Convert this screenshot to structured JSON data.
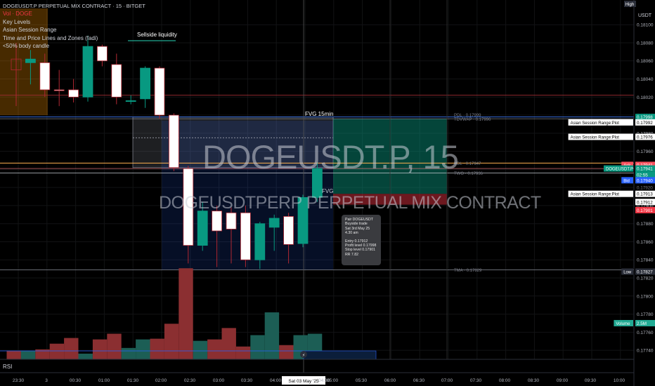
{
  "legend": {
    "title": "DOGEUSDT.P PERPETUAL MIX CONTRACT · 15 · BITGET",
    "vol": "Vol · DOGE",
    "indicators": [
      "Key Levels",
      "Asian Session Range",
      "Time and Price Lines and Zones (fadi)",
      "&lt;50% body candle"
    ]
  },
  "watermark": {
    "symbol": "DOGEUSDT.P, 15",
    "description": "DOGEUSDTPERP PERPETUAL MIX CONTRACT"
  },
  "annotations": {
    "sellside": "Sellside liquidity",
    "fvg_top": "FVG 15min",
    "fvg_mid": "FVG"
  },
  "key_levels": [
    {
      "label": "PDL · 0.17999",
      "value": 0.17998
    },
    {
      "label": "TDVWAP · 0.17996",
      "value": 0.17996
    },
    {
      "label": "YDL · 0.17947",
      "value": 0.17947
    },
    {
      "label": "TWO · 0.17936",
      "value": 0.17936
    },
    {
      "label": "TMA · 0.17829",
      "value": 0.17829
    }
  ],
  "tooltip": {
    "lines": [
      "Pair DOGEUSDT",
      "Buyside trade",
      "Sat 3rd May 25",
      "4.30 am"
    ],
    "lines2": [
      "Entry 0.17912",
      "Profit level 0.17998",
      "Stop level 0.17901",
      "RR 7.82"
    ]
  },
  "price_axis": {
    "currency": "USDT",
    "high_badge": "High",
    "ticks": [
      "0.18100",
      "0.18080",
      "0.18060",
      "0.18040",
      "0.18020",
      "0.18000",
      "0.17980",
      "0.17960",
      "0.17940",
      "0.17920",
      "0.17900",
      "0.17880",
      "0.17860",
      "0.17840",
      "0.17820",
      "0.17800",
      "0.17780",
      "0.17760",
      "0.17740"
    ],
    "badges": [
      {
        "label": "",
        "text": "0.17998",
        "bg": "#089981",
        "fg": "#ffffff",
        "value": 0.17998
      },
      {
        "label": "Asian Session Range:Plot",
        "text": "0.17992",
        "bg": "#ffffff",
        "fg": "#000000",
        "value": 0.17992
      },
      {
        "label": "Asian Session Range:Plot",
        "text": "0.17976",
        "bg": "#ffffff",
        "fg": "#000000",
        "value": 0.17976
      },
      {
        "label": "Ask",
        "text": "0.17941",
        "bg": "#f7525f",
        "fg": "#ffffff",
        "value": 0.17945
      },
      {
        "label": "DOGEUSDT.P",
        "text": "0.17941",
        "bg": "#089981",
        "fg": "#ffffff",
        "value": 0.17941
      },
      {
        "label": "",
        "text": "02:55",
        "bg": "#089981",
        "fg": "#ffffff",
        "value": 0.17934
      },
      {
        "label": "Bid",
        "text": "0.17940",
        "bg": "#2962ff",
        "fg": "#ffffff",
        "value": 0.17928
      },
      {
        "label": "",
        "text": "0.17920",
        "bg": "#000000",
        "fg": "#787b86",
        "value": 0.1792
      },
      {
        "label": "Asian Session Range:Plot",
        "text": "0.17913",
        "bg": "#ffffff",
        "fg": "#000000",
        "value": 0.17913
      },
      {
        "label": "",
        "text": "0.17912",
        "bg": "#ffffff",
        "fg": "#000000",
        "value": 0.17904
      },
      {
        "label": "",
        "text": "0.17901",
        "bg": "#f23645",
        "fg": "#ffffff",
        "value": 0.17895
      },
      {
        "label": "Low",
        "text": "0.17827",
        "bg": "#2a2e39",
        "fg": "#ffffff",
        "value": 0.17827
      },
      {
        "label": "Volume",
        "text": "2.5M",
        "bg": "#22ab94",
        "fg": "#ffffff",
        "value": 0.1777
      }
    ]
  },
  "time_axis": {
    "ticks": [
      "23:30",
      "3",
      "00:30",
      "01:00",
      "01:30",
      "02:00",
      "02:30",
      "03:00",
      "03:30",
      "04:00",
      "04:30",
      "05:00",
      "05:30",
      "06:00",
      "06:30",
      "07:00",
      "07:30",
      "08:00",
      "08:30",
      "09:00",
      "09:30",
      "10:00"
    ],
    "crosshair_label": "Sat 03 May '25"
  },
  "rsi_label": "RSI",
  "colors": {
    "up": "#089981",
    "down": "#f23645",
    "vol_up": "#1c5e55",
    "vol_down": "#8b2f31"
  },
  "chart_data": {
    "type": "candlestick",
    "timeframe": "15",
    "ylim": [
      0.1773,
      0.18118
    ],
    "candles": [
      {
        "t": "23:15",
        "o": 0.18062,
        "h": 0.1808,
        "l": 0.1801,
        "c": 0.1805
      },
      {
        "t": "23:30",
        "o": 0.18058,
        "h": 0.18072,
        "l": 0.18034,
        "c": 0.18062
      },
      {
        "t": "23:45",
        "o": 0.18058,
        "h": 0.18068,
        "l": 0.1802,
        "c": 0.18028
      },
      {
        "t": "00:00",
        "o": 0.18028,
        "h": 0.1805,
        "l": 0.1801,
        "c": 0.18027
      },
      {
        "t": "00:15",
        "o": 0.18028,
        "h": 0.1804,
        "l": 0.18014,
        "c": 0.1802
      },
      {
        "t": "00:30",
        "o": 0.1802,
        "h": 0.18088,
        "l": 0.18015,
        "c": 0.18076
      },
      {
        "t": "00:45",
        "o": 0.18076,
        "h": 0.18078,
        "l": 0.18054,
        "c": 0.1806
      },
      {
        "t": "01:00",
        "o": 0.18056,
        "h": 0.18068,
        "l": 0.18012,
        "c": 0.1802
      },
      {
        "t": "01:15",
        "o": 0.18016,
        "h": 0.18022,
        "l": 0.18012,
        "c": 0.18016
      },
      {
        "t": "01:30",
        "o": 0.18018,
        "h": 0.18054,
        "l": 0.18008,
        "c": 0.18052
      },
      {
        "t": "01:45",
        "o": 0.18052,
        "h": 0.18054,
        "l": 0.17996,
        "c": 0.18
      },
      {
        "t": "02:00",
        "o": 0.18,
        "h": 0.18002,
        "l": 0.17938,
        "c": 0.17942
      },
      {
        "t": "02:15",
        "o": 0.17941,
        "h": 0.17944,
        "l": 0.17836,
        "c": 0.17856
      },
      {
        "t": "02:30",
        "o": 0.17856,
        "h": 0.17904,
        "l": 0.1785,
        "c": 0.17894
      },
      {
        "t": "02:45",
        "o": 0.17894,
        "h": 0.179,
        "l": 0.17832,
        "c": 0.17872
      },
      {
        "t": "03:00",
        "o": 0.17892,
        "h": 0.17898,
        "l": 0.17836,
        "c": 0.17874
      },
      {
        "t": "03:15",
        "o": 0.17892,
        "h": 0.179,
        "l": 0.17832,
        "c": 0.1784
      },
      {
        "t": "03:30",
        "o": 0.1784,
        "h": 0.17882,
        "l": 0.1783,
        "c": 0.1788
      },
      {
        "t": "03:45",
        "o": 0.17876,
        "h": 0.1789,
        "l": 0.1785,
        "c": 0.17886
      },
      {
        "t": "04:00",
        "o": 0.17888,
        "h": 0.17892,
        "l": 0.17836,
        "c": 0.17857
      },
      {
        "t": "04:15",
        "o": 0.17858,
        "h": 0.17912,
        "l": 0.17854,
        "c": 0.17909
      },
      {
        "t": "04:30",
        "o": 0.17909,
        "h": 0.17948,
        "l": 0.17904,
        "c": 0.17941
      }
    ],
    "volume_ylim": [
      0,
      1.45
    ],
    "volume": [
      0.12,
      0.12,
      0.14,
      0.22,
      0.3,
      0.08,
      0.28,
      0.36,
      0.16,
      0.28,
      0.29,
      0.5,
      1.28,
      0.26,
      0.28,
      0.44,
      0.18,
      0.34,
      0.66,
      0.2,
      0.34,
      0.36
    ],
    "volume_ma_value": 0.07
  }
}
